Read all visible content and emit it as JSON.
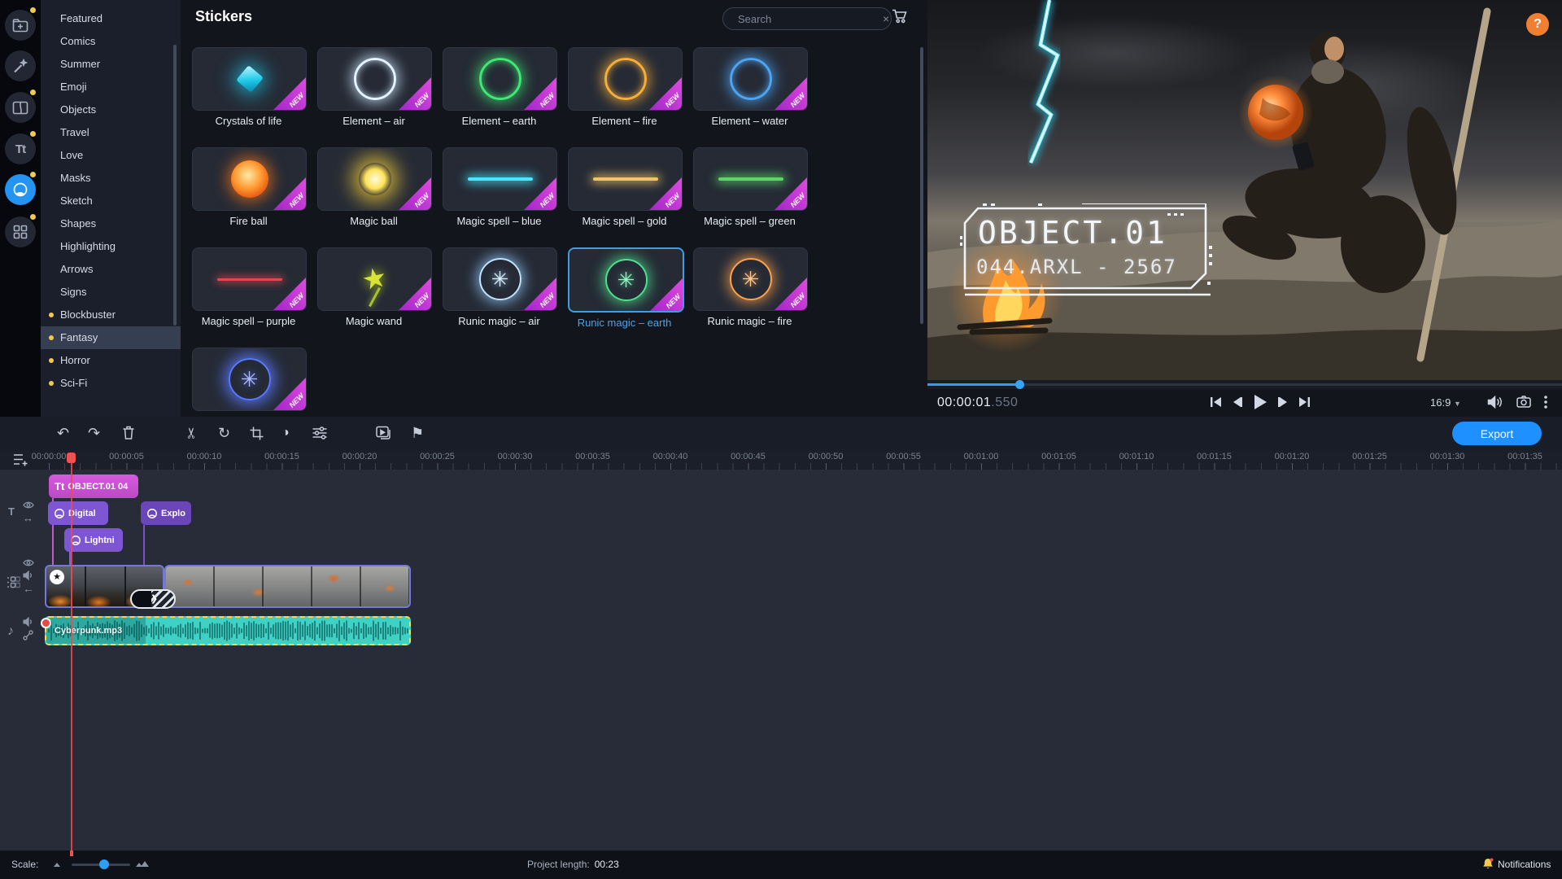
{
  "colors": {
    "accent_blue": "#2e9df7",
    "export_blue": "#1e90ff",
    "new_badge_magenta": "#d43ada",
    "selected_card_blue": "#3f9de0",
    "playhead_red": "#ef5350",
    "audio_clip_cyan": "#3fd0c6",
    "audio_border_yellow": "#ffd84a",
    "notification_dot_yellow": "#f2c94c",
    "help_orange": "#f07f32"
  },
  "left_rail": {
    "titles_glyph": "Tt",
    "items": [
      {
        "name": "import",
        "icon": "folder-plus-icon",
        "badge": true,
        "active": false
      },
      {
        "name": "filters",
        "icon": "magic-wand-icon",
        "badge": false,
        "active": false
      },
      {
        "name": "transitions",
        "icon": "transition-icon",
        "badge": true,
        "active": false
      },
      {
        "name": "titles",
        "icon": "titles-icon",
        "badge": true,
        "active": false
      },
      {
        "name": "stickers",
        "icon": "sticker-icon",
        "badge": true,
        "active": true
      },
      {
        "name": "more-tools",
        "icon": "grid-icon",
        "badge": true,
        "active": false
      }
    ]
  },
  "categories": {
    "items": [
      {
        "label": "Featured",
        "dot": false,
        "selected": false
      },
      {
        "label": "Comics",
        "dot": false,
        "selected": false
      },
      {
        "label": "Summer",
        "dot": false,
        "selected": false
      },
      {
        "label": "Emoji",
        "dot": false,
        "selected": false
      },
      {
        "label": "Objects",
        "dot": false,
        "selected": false
      },
      {
        "label": "Travel",
        "dot": false,
        "selected": false
      },
      {
        "label": "Love",
        "dot": false,
        "selected": false
      },
      {
        "label": "Masks",
        "dot": false,
        "selected": false
      },
      {
        "label": "Sketch",
        "dot": false,
        "selected": false
      },
      {
        "label": "Shapes",
        "dot": false,
        "selected": false
      },
      {
        "label": "Highlighting",
        "dot": false,
        "selected": false
      },
      {
        "label": "Arrows",
        "dot": false,
        "selected": false
      },
      {
        "label": "Signs",
        "dot": false,
        "selected": false
      },
      {
        "label": "Blockbuster",
        "dot": true,
        "selected": false
      },
      {
        "label": "Fantasy",
        "dot": true,
        "selected": true
      },
      {
        "label": "Horror",
        "dot": true,
        "selected": false
      },
      {
        "label": "Sci-Fi",
        "dot": true,
        "selected": false
      }
    ]
  },
  "stickers_panel": {
    "title": "Stickers",
    "search": {
      "placeholder": "Search"
    },
    "badge_text": "NEW",
    "cards": [
      {
        "label": "Crystals of life",
        "art": "crystal",
        "new": true,
        "selected": false
      },
      {
        "label": "Element – air",
        "art": "ring-silver",
        "new": true,
        "selected": false
      },
      {
        "label": "Element – earth",
        "art": "ring-green",
        "new": true,
        "selected": false
      },
      {
        "label": "Element – fire",
        "art": "ring-orange",
        "new": true,
        "selected": false
      },
      {
        "label": "Element – water",
        "art": "ring-blue",
        "new": true,
        "selected": false
      },
      {
        "label": "Fire ball",
        "art": "fireball",
        "new": true,
        "selected": false
      },
      {
        "label": "Magic ball",
        "art": "burst",
        "new": true,
        "selected": false
      },
      {
        "label": "Magic spell – blue",
        "art": "streak-cyan",
        "new": true,
        "selected": false
      },
      {
        "label": "Magic spell – gold",
        "art": "streak-gold",
        "new": true,
        "selected": false
      },
      {
        "label": "Magic spell – green",
        "art": "streak-green",
        "new": true,
        "selected": false
      },
      {
        "label": "Magic spell – purple",
        "art": "streak-red",
        "new": true,
        "selected": false
      },
      {
        "label": "Magic wand",
        "art": "wand",
        "new": true,
        "selected": false
      },
      {
        "label": "Runic magic – air",
        "art": "rune-air",
        "new": true,
        "selected": false
      },
      {
        "label": "Runic magic – earth",
        "art": "rune-earth",
        "new": true,
        "selected": true
      },
      {
        "label": "Runic magic – fire",
        "art": "rune-fire",
        "new": true,
        "selected": false
      },
      {
        "label": "",
        "art": "rune-water",
        "new": true,
        "selected": false
      }
    ]
  },
  "preview": {
    "hud_title": "OBJECT.01",
    "hud_subtitle": "044.ARXL - 2567",
    "help_label": "?",
    "timecode": "00:00:01",
    "timecode_ms": ".550",
    "aspect_ratio": "16:9",
    "progress_percent": 14.5
  },
  "timeline": {
    "export_label": "Export",
    "ruler_labels": [
      "00:00:00",
      "00:00:05",
      "00:00:10",
      "00:00:15",
      "00:00:20",
      "00:00:25",
      "00:00:30",
      "00:00:35",
      "00:00:40",
      "00:00:45",
      "00:00:50",
      "00:00:55",
      "00:01:00",
      "00:01:05",
      "00:01:10",
      "00:01:15",
      "00:01:20",
      "00:01:25",
      "00:01:30",
      "00:01:35"
    ],
    "clips": {
      "title": {
        "label": "OBJECT.01 04"
      },
      "stickers": [
        {
          "label": "Digital"
        },
        {
          "label": "Explo"
        },
        {
          "label": "Lightni"
        }
      ],
      "audio": {
        "label": "Cyberpunk.mp3"
      }
    }
  },
  "status_bar": {
    "scale_label": "Scale:",
    "project_length_label": "Project length:",
    "project_length_value": "00:23",
    "notifications_label": "Notifications"
  }
}
